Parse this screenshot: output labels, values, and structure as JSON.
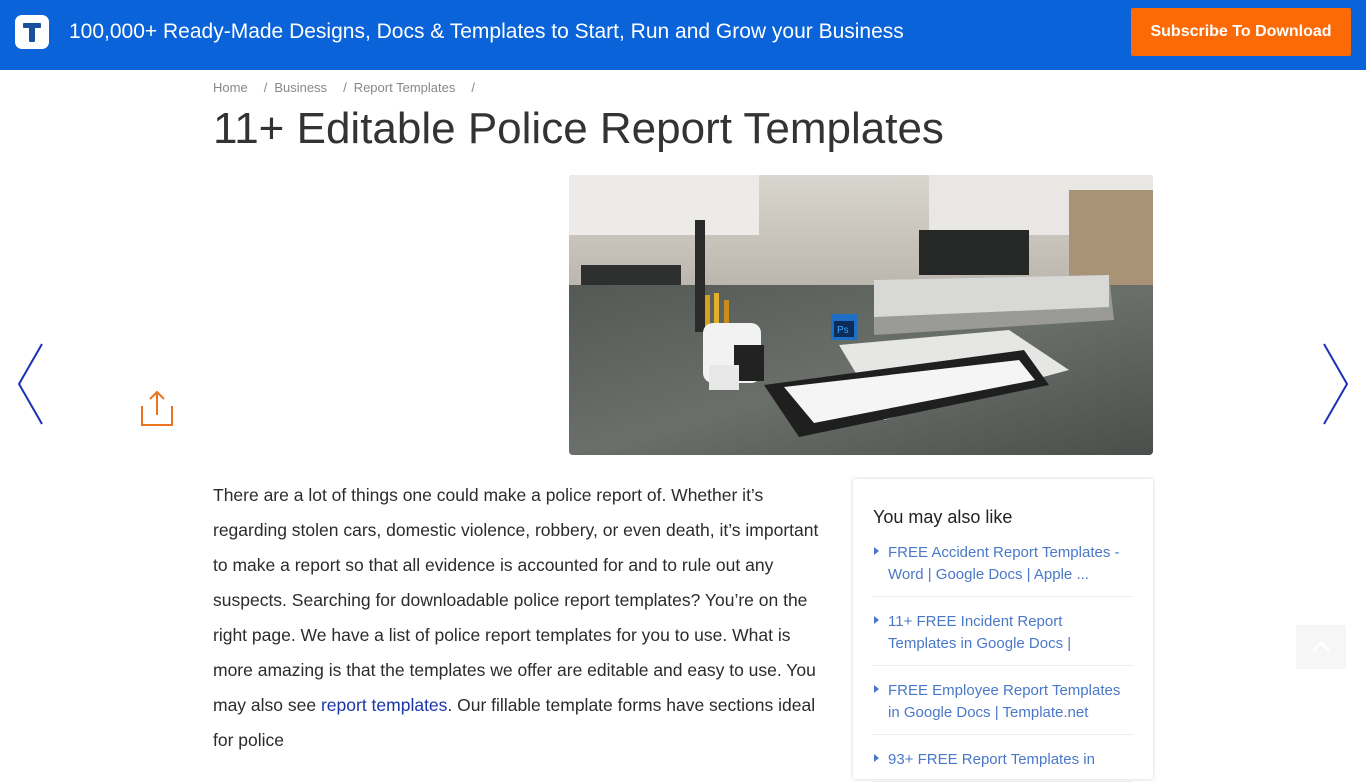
{
  "topbar": {
    "logo_letter": "T",
    "tagline": "100,000+ Ready-Made Designs, Docs & Templates to Start, Run and Grow your Business",
    "subscribe_label": "Subscribe To Download",
    "colors": {
      "bar": "#0a63d9",
      "button": "#fb6a06"
    }
  },
  "breadcrumb": {
    "items": [
      {
        "label": "Home"
      },
      {
        "label": "Business"
      },
      {
        "label": "Report Templates"
      }
    ],
    "separator": "/"
  },
  "page": {
    "title": "11+ Editable Police Report Templates"
  },
  "hero_image": {
    "alt": "Desk with pen holder, Photoshop cube, drawing tablet and book"
  },
  "icons": {
    "prev": "chevron-left-icon",
    "next": "chevron-right-icon",
    "share": "share-icon",
    "back_to_top": "chevron-up-icon"
  },
  "article": {
    "intro_before_link": "There are a lot of things one could make a police report of. Whether it’s regarding stolen cars, domestic violence, robbery, or even death, it’s important to make a report so that all evidence is accounted for and to rule out any suspects. Searching for downloadable police report templates? You’re on the right page. We have a list of police report templates for you to use. What is more amazing is that the templates we offer are editable and easy to use. You may also see ",
    "link_text": "report templates",
    "intro_after_link": ". Our fillable template forms have sections ideal for police"
  },
  "related": {
    "heading": "You may also like",
    "items": [
      {
        "label": "FREE Accident Report Templates - Word | Google Docs | Apple ..."
      },
      {
        "label": "11+ FREE Incident Report Templates in Google Docs |"
      },
      {
        "label": "FREE Employee Report Templates in Google Docs | Template.net"
      },
      {
        "label": "93+ FREE Report Templates in"
      }
    ]
  }
}
